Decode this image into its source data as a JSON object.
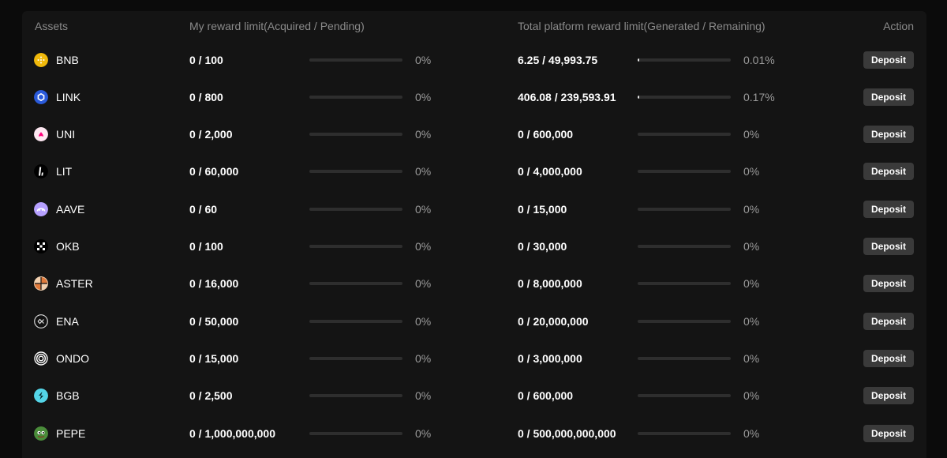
{
  "table": {
    "headers": {
      "assets": "Assets",
      "my_reward": "My reward limit(Acquired / Pending)",
      "total_reward": "Total platform reward limit(Generated / Remaining)",
      "action": "Action"
    },
    "rows": [
      {
        "asset": "BNB",
        "icon": "bnb-icon",
        "my_limit": "0 / 100",
        "my_pct": "0%",
        "my_fill": 0,
        "total_limit": "6.25 / 49,993.75",
        "total_pct": "0.01%",
        "total_fill": 0.0001,
        "action": "Deposit"
      },
      {
        "asset": "LINK",
        "icon": "link-icon",
        "my_limit": "0 / 800",
        "my_pct": "0%",
        "my_fill": 0,
        "total_limit": "406.08 / 239,593.91",
        "total_pct": "0.17%",
        "total_fill": 0.0017,
        "action": "Deposit"
      },
      {
        "asset": "UNI",
        "icon": "uni-icon",
        "my_limit": "0 / 2,000",
        "my_pct": "0%",
        "my_fill": 0,
        "total_limit": "0 / 600,000",
        "total_pct": "0%",
        "total_fill": 0,
        "action": "Deposit"
      },
      {
        "asset": "LIT",
        "icon": "lit-icon",
        "my_limit": "0 / 60,000",
        "my_pct": "0%",
        "my_fill": 0,
        "total_limit": "0 / 4,000,000",
        "total_pct": "0%",
        "total_fill": 0,
        "action": "Deposit"
      },
      {
        "asset": "AAVE",
        "icon": "aave-icon",
        "my_limit": "0 / 60",
        "my_pct": "0%",
        "my_fill": 0,
        "total_limit": "0 / 15,000",
        "total_pct": "0%",
        "total_fill": 0,
        "action": "Deposit"
      },
      {
        "asset": "OKB",
        "icon": "okb-icon",
        "my_limit": "0 / 100",
        "my_pct": "0%",
        "my_fill": 0,
        "total_limit": "0 / 30,000",
        "total_pct": "0%",
        "total_fill": 0,
        "action": "Deposit"
      },
      {
        "asset": "ASTER",
        "icon": "aster-icon",
        "my_limit": "0 / 16,000",
        "my_pct": "0%",
        "my_fill": 0,
        "total_limit": "0 / 8,000,000",
        "total_pct": "0%",
        "total_fill": 0,
        "action": "Deposit"
      },
      {
        "asset": "ENA",
        "icon": "ena-icon",
        "my_limit": "0 / 50,000",
        "my_pct": "0%",
        "my_fill": 0,
        "total_limit": "0 / 20,000,000",
        "total_pct": "0%",
        "total_fill": 0,
        "action": "Deposit"
      },
      {
        "asset": "ONDO",
        "icon": "ondo-icon",
        "my_limit": "0 / 15,000",
        "my_pct": "0%",
        "my_fill": 0,
        "total_limit": "0 / 3,000,000",
        "total_pct": "0%",
        "total_fill": 0,
        "action": "Deposit"
      },
      {
        "asset": "BGB",
        "icon": "bgb-icon",
        "my_limit": "0 / 2,500",
        "my_pct": "0%",
        "my_fill": 0,
        "total_limit": "0 / 600,000",
        "total_pct": "0%",
        "total_fill": 0,
        "action": "Deposit"
      },
      {
        "asset": "PEPE",
        "icon": "pepe-icon",
        "my_limit": "0 / 1,000,000,000",
        "my_pct": "0%",
        "my_fill": 0,
        "total_limit": "0 / 500,000,000,000",
        "total_pct": "0%",
        "total_fill": 0,
        "action": "Deposit"
      }
    ]
  },
  "colors": {
    "page_bg": "#0b0b0b",
    "panel_bg": "#141414",
    "button_bg": "#3a3a3a",
    "bar_track": "#2e2e2e",
    "bar_fill": "#e8e8e8",
    "header_text": "#8a8a8a"
  }
}
